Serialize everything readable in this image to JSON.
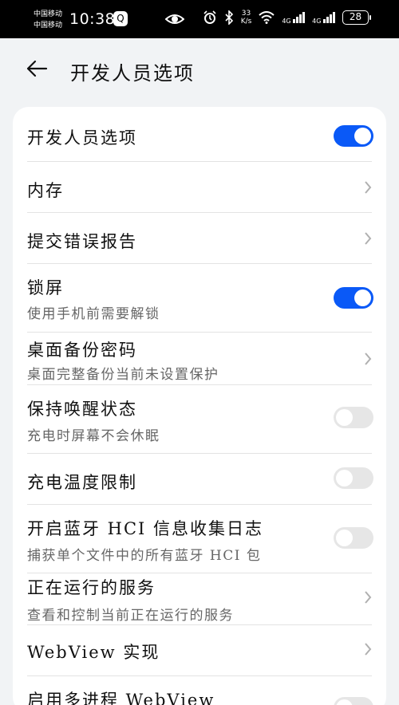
{
  "status_bar": {
    "carrier_1": "中国移动",
    "carrier_2": "中国移动",
    "time": "10:38",
    "qq_icon_label": "Q",
    "net_speed_value": "33",
    "net_speed_unit": "K/s",
    "signal_1_label": "4G",
    "signal_2_label": "4G",
    "battery": "28"
  },
  "header": {
    "title": "开发人员选项"
  },
  "settings": [
    {
      "title": "开发人员选项",
      "control": "toggle",
      "enabled": true
    },
    {
      "title": "内存",
      "control": "chevron"
    },
    {
      "title": "提交错误报告",
      "control": "chevron"
    },
    {
      "title": "锁屏",
      "subtitle": "使用手机前需要解锁",
      "control": "toggle",
      "enabled": true
    },
    {
      "title": "桌面备份密码",
      "subtitle": "桌面完整备份当前未设置保护",
      "control": "chevron"
    },
    {
      "title": "保持唤醒状态",
      "subtitle": "充电时屏幕不会休眠",
      "control": "toggle",
      "enabled": false
    },
    {
      "title": "充电温度限制",
      "control": "toggle",
      "enabled": false
    },
    {
      "title": "开启蓝牙 HCI 信息收集日志",
      "subtitle": "捕获单个文件中的所有蓝牙 HCI 包",
      "control": "toggle",
      "enabled": false
    },
    {
      "title": "正在运行的服务",
      "subtitle": "查看和控制当前正在运行的服务",
      "control": "chevron"
    },
    {
      "title": "WebView 实现",
      "control": "chevron"
    },
    {
      "title": "启用多进程 WebView",
      "control": "toggle",
      "enabled": false
    }
  ],
  "colors": {
    "accent": "#0a59f7",
    "toggle_off": "#e6e6e6",
    "page_background": "#f1f3f5",
    "card_background": "#ffffff"
  }
}
